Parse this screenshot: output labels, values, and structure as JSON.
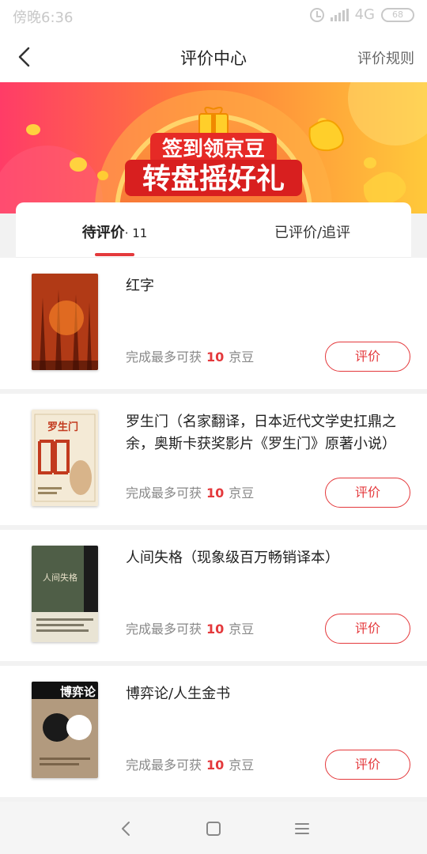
{
  "status_bar": {
    "time": "傍晚6:36",
    "network": "4G",
    "battery": "68"
  },
  "header": {
    "title": "评价中心",
    "rules_link": "评价规则"
  },
  "banner": {
    "line1": "签到领京豆",
    "line2": "转盘摇好礼"
  },
  "tabs": [
    {
      "label": "待评价",
      "count": "· 11"
    },
    {
      "label": "已评价/追评"
    }
  ],
  "reward": {
    "prefix": "完成最多可获",
    "suffix": "京豆"
  },
  "items": [
    {
      "title": "红字",
      "points": "10",
      "button": "评价"
    },
    {
      "title": "罗生门（名家翻译，日本近代文学史扛鼎之余，奥斯卡获奖影片《罗生门》原著小说）",
      "points": "10",
      "button": "评价"
    },
    {
      "title": "人间失格（现象级百万畅销译本）",
      "points": "10",
      "button": "评价"
    },
    {
      "title": "博弈论/人生金书",
      "points": "10",
      "button": "评价"
    }
  ],
  "covers": [
    {
      "text": ""
    },
    {
      "text": "罗生门"
    },
    {
      "text": "人间失格"
    },
    {
      "text": "博弈论"
    }
  ],
  "colors": {
    "accent": "#e4393c",
    "banner_gold": "#ffc53d"
  }
}
